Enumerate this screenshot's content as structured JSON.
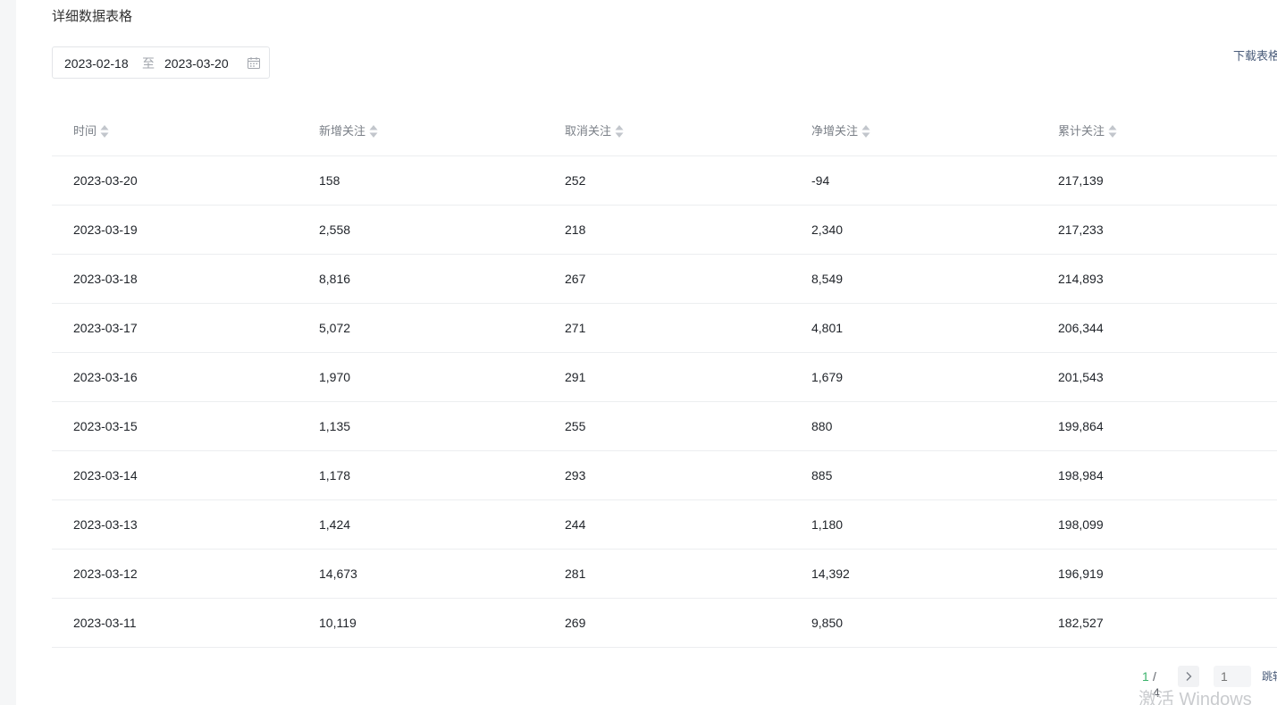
{
  "section": {
    "title": "详细数据表格"
  },
  "date_range": {
    "start": "2023-02-18",
    "separator": "至",
    "end": "2023-03-20",
    "icon": "calendar-icon"
  },
  "download": {
    "label": "下载表格"
  },
  "table": {
    "columns": [
      "时间",
      "新增关注",
      "取消关注",
      "净增关注",
      "累计关注"
    ],
    "sort_icon": "sort-icon",
    "rows": [
      [
        "2023-03-20",
        "158",
        "252",
        "-94",
        "217,139"
      ],
      [
        "2023-03-19",
        "2,558",
        "218",
        "2,340",
        "217,233"
      ],
      [
        "2023-03-18",
        "8,816",
        "267",
        "8,549",
        "214,893"
      ],
      [
        "2023-03-17",
        "5,072",
        "271",
        "4,801",
        "206,344"
      ],
      [
        "2023-03-16",
        "1,970",
        "291",
        "1,679",
        "201,543"
      ],
      [
        "2023-03-15",
        "1,135",
        "255",
        "880",
        "199,864"
      ],
      [
        "2023-03-14",
        "1,178",
        "293",
        "885",
        "198,984"
      ],
      [
        "2023-03-13",
        "1,424",
        "244",
        "1,180",
        "198,099"
      ],
      [
        "2023-03-12",
        "14,673",
        "281",
        "14,392",
        "196,919"
      ],
      [
        "2023-03-11",
        "10,119",
        "269",
        "9,850",
        "182,527"
      ]
    ]
  },
  "pagination": {
    "current": "1",
    "total_text": "/ 4",
    "input_placeholder": "1",
    "jump_label": "跳转",
    "next_icon": "chevron-right-icon"
  },
  "watermark": {
    "text": "激活 Windows"
  },
  "colors": {
    "accent_green": "#3cb36b",
    "link_blue": "#4a5c7a",
    "divider": "#eceef0"
  }
}
